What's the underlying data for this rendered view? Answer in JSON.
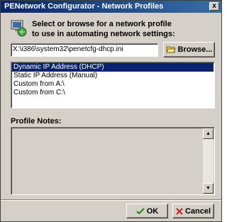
{
  "window": {
    "title": "PENetwork Configurator - Network Profiles",
    "close_label": "x"
  },
  "header": {
    "prompt_line1": "Select or browse for a network profile",
    "prompt_line2": "to use in automating network settings:"
  },
  "path": {
    "value": "X:\\i386\\system32\\penetcfg-dhcp.ini"
  },
  "browse_button": {
    "label": "Browse..."
  },
  "profiles": {
    "items": [
      {
        "label": "Dynamic IP Address (DHCP)",
        "selected": true
      },
      {
        "label": "Static IP Address (Manual)",
        "selected": false
      },
      {
        "label": "Custom from A:\\",
        "selected": false
      },
      {
        "label": "Custom from C:\\",
        "selected": false
      }
    ]
  },
  "notes": {
    "label": "Profile Notes:",
    "value": ""
  },
  "footer": {
    "ok_label": "OK",
    "cancel_label": "Cancel"
  },
  "colors": {
    "title_bar": "#0a246a",
    "selection": "#0a246a",
    "face": "#d4d0c8"
  },
  "icons": [
    "network-profile-icon",
    "folder-open-icon",
    "checkmark-icon",
    "cancel-x-icon",
    "close-icon",
    "arrow-up-icon",
    "arrow-down-icon"
  ]
}
